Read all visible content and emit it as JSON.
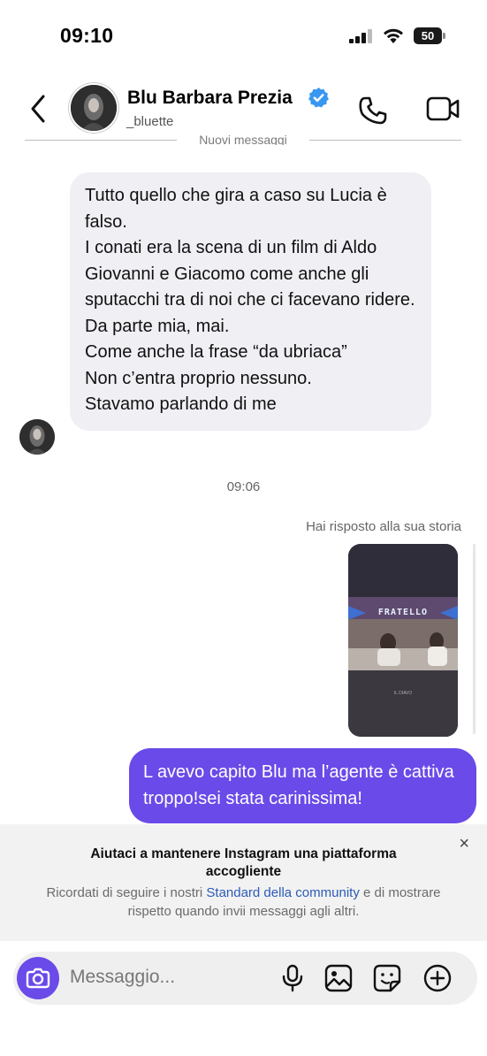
{
  "status_bar": {
    "time": "09:10",
    "battery": "50"
  },
  "header": {
    "name": "Blu Barbara Prezia",
    "username": "_bluette",
    "icons": [
      "back-chevron-icon",
      "verified-badge-icon",
      "phone-icon",
      "video-camera-icon"
    ]
  },
  "divider_label": "Nuovi messaggi",
  "incoming_message": {
    "lines": [
      "Tutto quello che gira a caso su Lucia è falso.",
      "I conati era la scena di un film di Aldo Giovanni e Giacomo come anche gli sputacchi tra di noi che ci facevano ridere.",
      "Da parte mia, mai.",
      "Come anche la frase “da ubriaca”",
      "Non c’entra proprio nessuno.",
      "Stavamo parlando di me"
    ]
  },
  "timestamp": "09:06",
  "reply_note": "Hai risposto alla sua storia",
  "story": {
    "banner_text": "FRATELLO",
    "caption": "IL DIAVO"
  },
  "outgoing_message": "L avevo capito Blu ma l’agente è cattiva troppo!sei stata carinissima!",
  "banner": {
    "title": "Aiutaci a mantenere Instagram una piattaforma accogliente",
    "body_before": "Ricordati di seguire i nostri ",
    "link": "Standard della community",
    "body_after": " e di mostrare rispetto quando invii messaggi agli altri.",
    "close": "×"
  },
  "composer": {
    "placeholder": "Messaggio...",
    "icons": [
      "camera-icon",
      "microphone-icon",
      "gallery-icon",
      "sticker-icon",
      "add-icon"
    ]
  },
  "colors": {
    "accent": "#6a4ae8",
    "verified": "#3897f0",
    "incoming_bubble": "#efeff4",
    "link": "#2b5bb8"
  }
}
